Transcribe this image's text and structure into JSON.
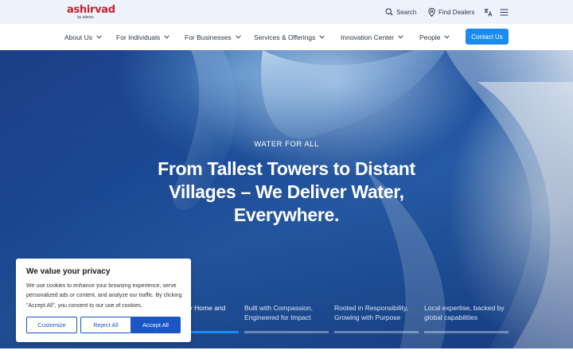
{
  "brand": {
    "name": "ashirvad",
    "sub": "by aliaxis",
    "color": "#c8202f"
  },
  "utility": {
    "search_label": "Search",
    "dealers_label": "Find Dealers"
  },
  "nav": {
    "items": [
      {
        "label": "About Us"
      },
      {
        "label": "For Individuals"
      },
      {
        "label": "For Businesses"
      },
      {
        "label": "Services & Offerings"
      },
      {
        "label": "Innovation Center"
      },
      {
        "label": "People"
      }
    ],
    "contact_label": "Contact Us",
    "accent": "#1a8cf0"
  },
  "hero": {
    "eyebrow": "WATER FOR ALL",
    "title": "From Tallest Towers to Distant Villages – We Deliver Water, Everywhere.",
    "slides": [
      {
        "text": "ery Home and",
        "active": true
      },
      {
        "text": "Built with Compassion, Engineered for Impact",
        "active": false
      },
      {
        "text": "Rooted in Responsibility, Growing with Purpose",
        "active": false
      },
      {
        "text": "Local expertise, backed by global capabilities",
        "active": false
      }
    ]
  },
  "cookie": {
    "title": "We value your privacy",
    "body": "We use cookies to enhance your browsing experience, serve personalized ads or content, and analyze our traffic. By clicking \"Accept All\", you consent to our use of cookies.",
    "customize_label": "Customize",
    "reject_label": "Reject All",
    "accept_label": "Accept All",
    "button_color": "#1a56c4"
  }
}
